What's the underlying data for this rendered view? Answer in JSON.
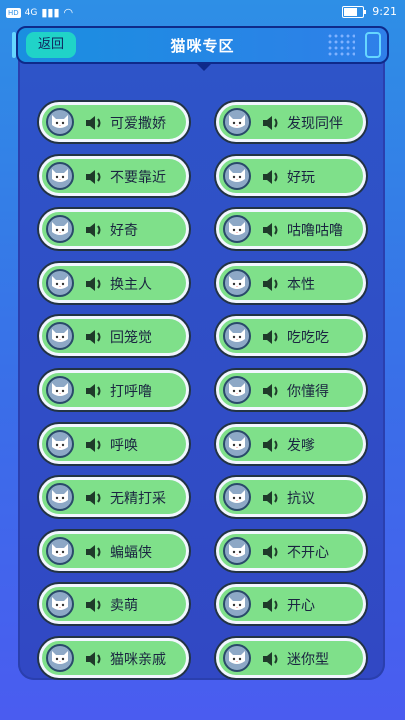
{
  "status": {
    "time": "9:21",
    "left_text": "HD",
    "network": "4G"
  },
  "header": {
    "title": "猫咪专区",
    "back_label": "返回"
  },
  "left_column": [
    {
      "label": "可爱撒娇"
    },
    {
      "label": "不要靠近"
    },
    {
      "label": "好奇"
    },
    {
      "label": "换主人"
    },
    {
      "label": "回笼觉"
    },
    {
      "label": "打呼噜"
    },
    {
      "label": "呼唤"
    },
    {
      "label": "无精打采"
    },
    {
      "label": "蝙蝠侠"
    },
    {
      "label": "卖萌"
    },
    {
      "label": "猫咪亲戚"
    }
  ],
  "right_column": [
    {
      "label": "发现同伴"
    },
    {
      "label": "好玩"
    },
    {
      "label": "咕噜咕噜"
    },
    {
      "label": "本性"
    },
    {
      "label": "吃吃吃"
    },
    {
      "label": "你懂得"
    },
    {
      "label": "发嗲"
    },
    {
      "label": "抗议"
    },
    {
      "label": "不开心"
    },
    {
      "label": "开心"
    },
    {
      "label": "迷你型"
    }
  ],
  "icons": {
    "button_avatar": "cat-face-icon",
    "sound": "speaker-icon"
  }
}
